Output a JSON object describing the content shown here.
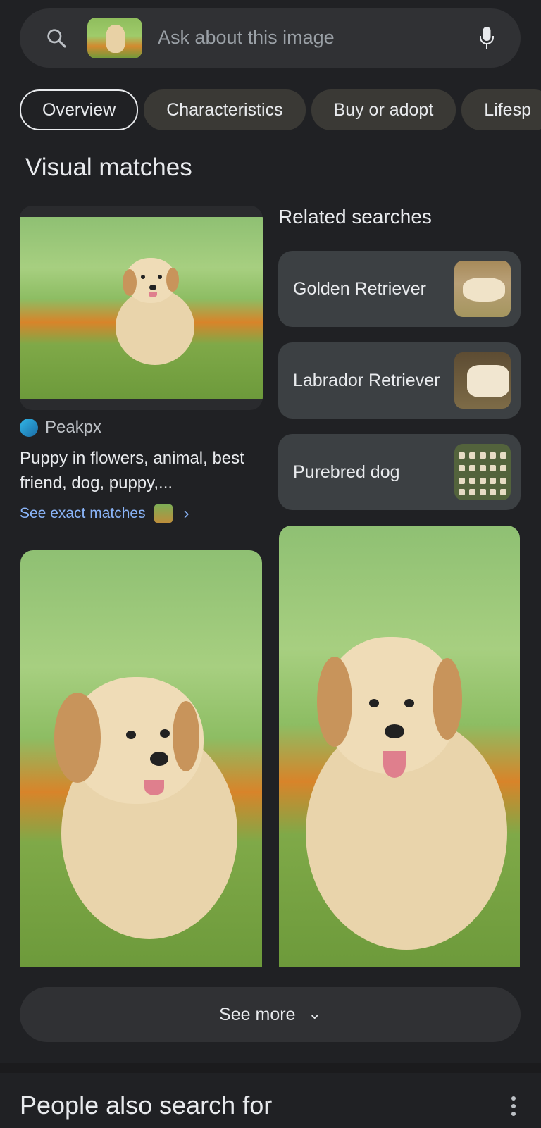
{
  "search": {
    "placeholder": "Ask about this image",
    "thumbnail_icon": "puppy-thumbnail"
  },
  "chips": [
    {
      "label": "Overview",
      "active": true
    },
    {
      "label": "Characteristics",
      "active": false
    },
    {
      "label": "Buy or adopt",
      "active": false
    },
    {
      "label": "Lifesp",
      "active": false
    }
  ],
  "visual_matches": {
    "title": "Visual matches",
    "result": {
      "source": "Peakpx",
      "title": "Puppy in flowers, animal, best friend, dog, puppy,...",
      "exact_link": "See exact matches"
    }
  },
  "related": {
    "title": "Related searches",
    "items": [
      {
        "label": "Golden Retriever"
      },
      {
        "label": "Labrador Retriever"
      },
      {
        "label": "Purebred dog"
      }
    ]
  },
  "see_more": {
    "label": "See more"
  },
  "people_also": {
    "title": "People also search for"
  },
  "colors": {
    "background": "#202124",
    "link": "#8ab4f8",
    "surface": "#303134",
    "card": "#3c4043"
  }
}
